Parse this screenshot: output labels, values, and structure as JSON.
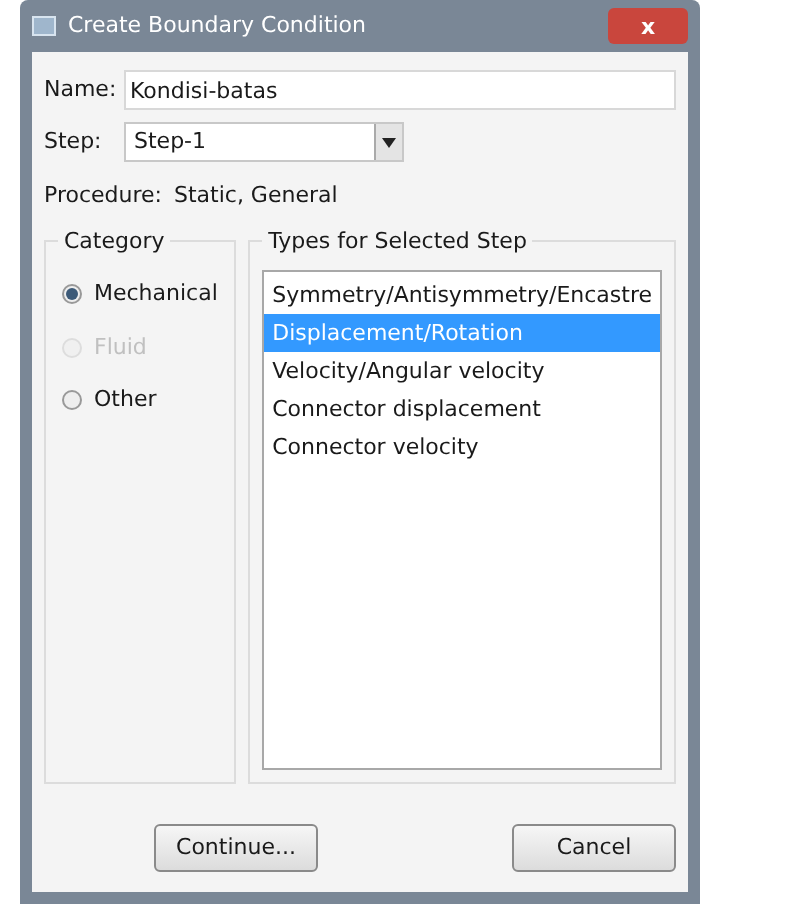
{
  "window": {
    "title": "Create Boundary Condition",
    "close": "x"
  },
  "name": {
    "label": "Name:",
    "value": "Kondisi-batas"
  },
  "step": {
    "label": "Step:",
    "value": "Step-1"
  },
  "procedure": {
    "label": "Procedure:",
    "value": "Static, General"
  },
  "category": {
    "title": "Category",
    "options": [
      {
        "label": "Mechanical",
        "selected": true,
        "disabled": false
      },
      {
        "label": "Fluid",
        "selected": false,
        "disabled": true
      },
      {
        "label": "Other",
        "selected": false,
        "disabled": false
      }
    ]
  },
  "types": {
    "title": "Types for Selected Step",
    "items": [
      {
        "label": "Symmetry/Antisymmetry/Encastre",
        "selected": false
      },
      {
        "label": "Displacement/Rotation",
        "selected": true
      },
      {
        "label": "Velocity/Angular velocity",
        "selected": false
      },
      {
        "label": "Connector displacement",
        "selected": false
      },
      {
        "label": "Connector velocity",
        "selected": false
      }
    ]
  },
  "buttons": [
    "Continue...",
    "Cancel"
  ]
}
